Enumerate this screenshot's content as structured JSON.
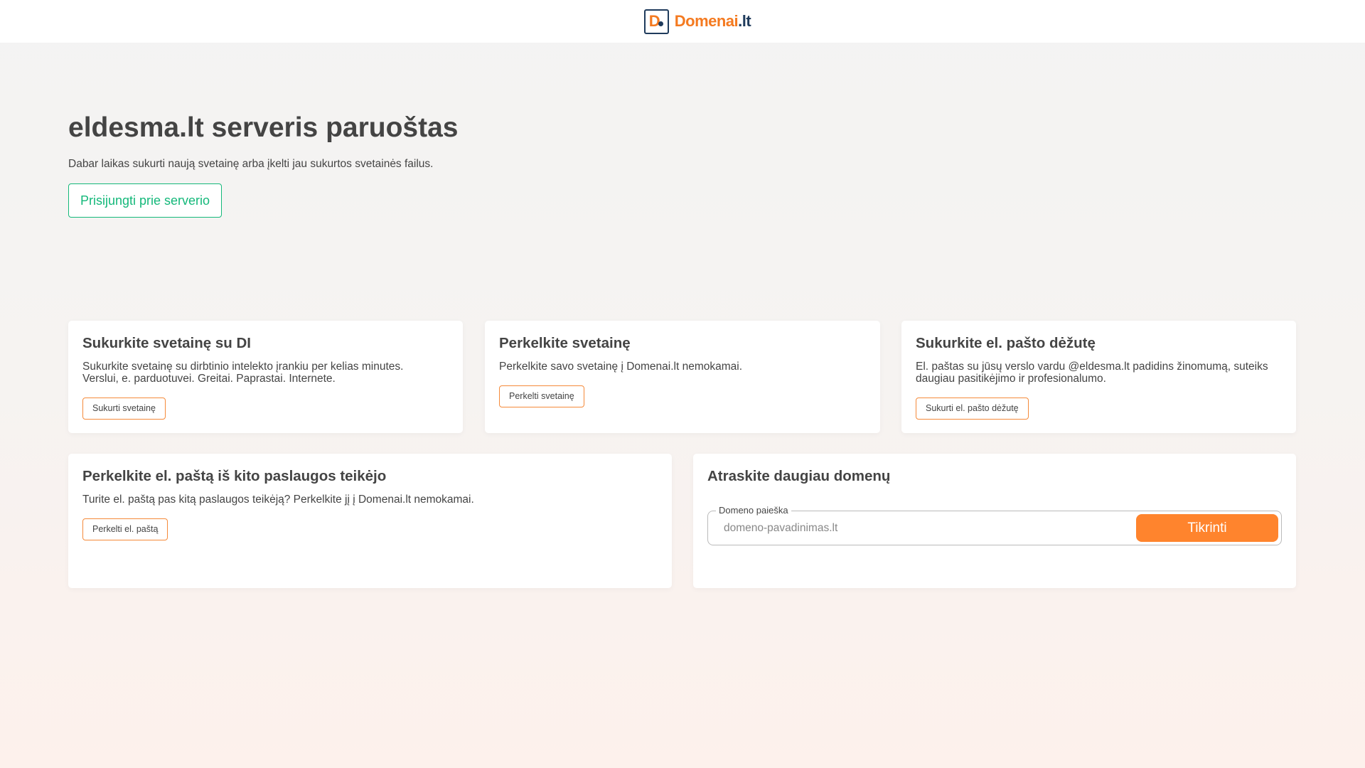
{
  "header": {
    "logo_letter": "D",
    "logo_text_main": "Domenai",
    "logo_text_tld": ".lt"
  },
  "hero": {
    "title": "eldesma.lt serveris paruoštas",
    "subtitle": "Dabar laikas sukurti naują svetainę arba įkelti jau sukurtos svetainės failus.",
    "button": "Prisijungti prie serverio"
  },
  "cards": [
    {
      "title": "Sukurkite svetainę su DI",
      "text1": "Sukurkite svetainę su dirbtinio intelekto įrankiu per kelias minutes.",
      "text2": "Verslui, e. parduotuvei. Greitai. Paprastai. Internete.",
      "button": "Sukurti svetainę"
    },
    {
      "title": "Perkelkite svetainę",
      "text1": "Perkelkite savo svetainę į Domenai.lt nemokamai.",
      "button": "Perkelti svetainę"
    },
    {
      "title": "Sukurkite el. pašto dėžutę",
      "text1": "El. paštas su jūsų verslo vardu @eldesma.lt padidins žinomumą, suteiks daugiau pasitikėjimo ir profesionalumo.",
      "button": "Sukurti el. pašto dėžutę"
    },
    {
      "title": "Perkelkite el. paštą iš kito paslaugos teikėjo",
      "text1": "Turite el. paštą pas kitą paslaugos teikėją? Perkelkite jį į Domenai.lt nemokamai.",
      "button": "Perkelti el. paštą"
    }
  ],
  "domain_search": {
    "title": "Atraskite daugiau domenų",
    "legend": "Domeno paieška",
    "placeholder": "domeno-pavadinimas.lt",
    "value": "",
    "button": "Tikrinti"
  }
}
